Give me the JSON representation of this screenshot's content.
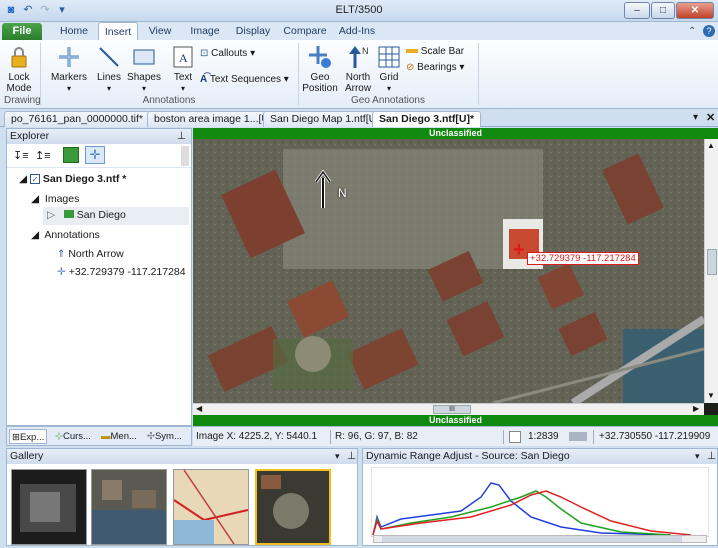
{
  "window": {
    "title": "ELT/3500",
    "minimize": "–",
    "maximize": "□",
    "close": "✕"
  },
  "qat": [
    "⟲",
    "↶",
    "↷",
    "▾"
  ],
  "ribbon_tabs": [
    {
      "label": "File"
    },
    {
      "label": "Home"
    },
    {
      "label": "Insert",
      "active": true
    },
    {
      "label": "View"
    },
    {
      "label": "Image"
    },
    {
      "label": "Display"
    },
    {
      "label": "Compare"
    },
    {
      "label": "Add-Ins"
    }
  ],
  "ribbon": {
    "lock_mode": "Lock\nMode",
    "markers": "Markers",
    "lines": "Lines",
    "shapes": "Shapes",
    "text": "Text",
    "callouts": "Callouts",
    "text_sequences": "Text Sequences",
    "geo_position": "Geo\nPosition",
    "north_arrow": "North\nArrow",
    "grid": "Grid",
    "scale_bar": "Scale Bar",
    "bearings": "Bearings",
    "group_drawing": "Drawing",
    "group_annotations": "Annotations",
    "group_geo": "Geo Annotations"
  },
  "doc_tabs": [
    {
      "label": "po_76161_pan_0000000.tif*"
    },
    {
      "label": "boston area image 1...[U]"
    },
    {
      "label": "San Diego Map 1.ntf[U]"
    },
    {
      "label": "San Diego 3.ntf[U]*",
      "active": true
    }
  ],
  "explorer": {
    "title": "Explorer",
    "root": "San Diego 3.ntf *",
    "images_label": "Images",
    "image_item": "San Diego",
    "annotations_label": "Annotations",
    "annotation_1": "North Arrow",
    "annotation_2": "+32.729379 -117.217284",
    "tabs": [
      "Exp...",
      "Curs...",
      "Men...",
      "Sym..."
    ]
  },
  "viewer": {
    "classification_top": "Unclassified",
    "classification_bottom": "Unclassified",
    "north_label": "N",
    "marker_label": "+32.729379 -117.217284",
    "hscroll_thumb": "III"
  },
  "status": {
    "image_xy": "Image X: 4225.2, Y: 5440.1",
    "rgb": "R: 96, G: 97, B: 82",
    "scale": "1:2839",
    "geo": "+32.730550 -117.219909"
  },
  "gallery": {
    "title": "Gallery",
    "thumbs": [
      "thumb-1",
      "thumb-2",
      "thumb-3",
      "thumb-4"
    ]
  },
  "dra": {
    "title": "Dynamic Range Adjust - Source:  San Diego"
  },
  "colors": {
    "accent": "#2b6cb0",
    "unclassified": "#0f8a0f",
    "histogram_red": "#e02020",
    "histogram_green": "#20a020",
    "histogram_blue": "#2040e0"
  }
}
